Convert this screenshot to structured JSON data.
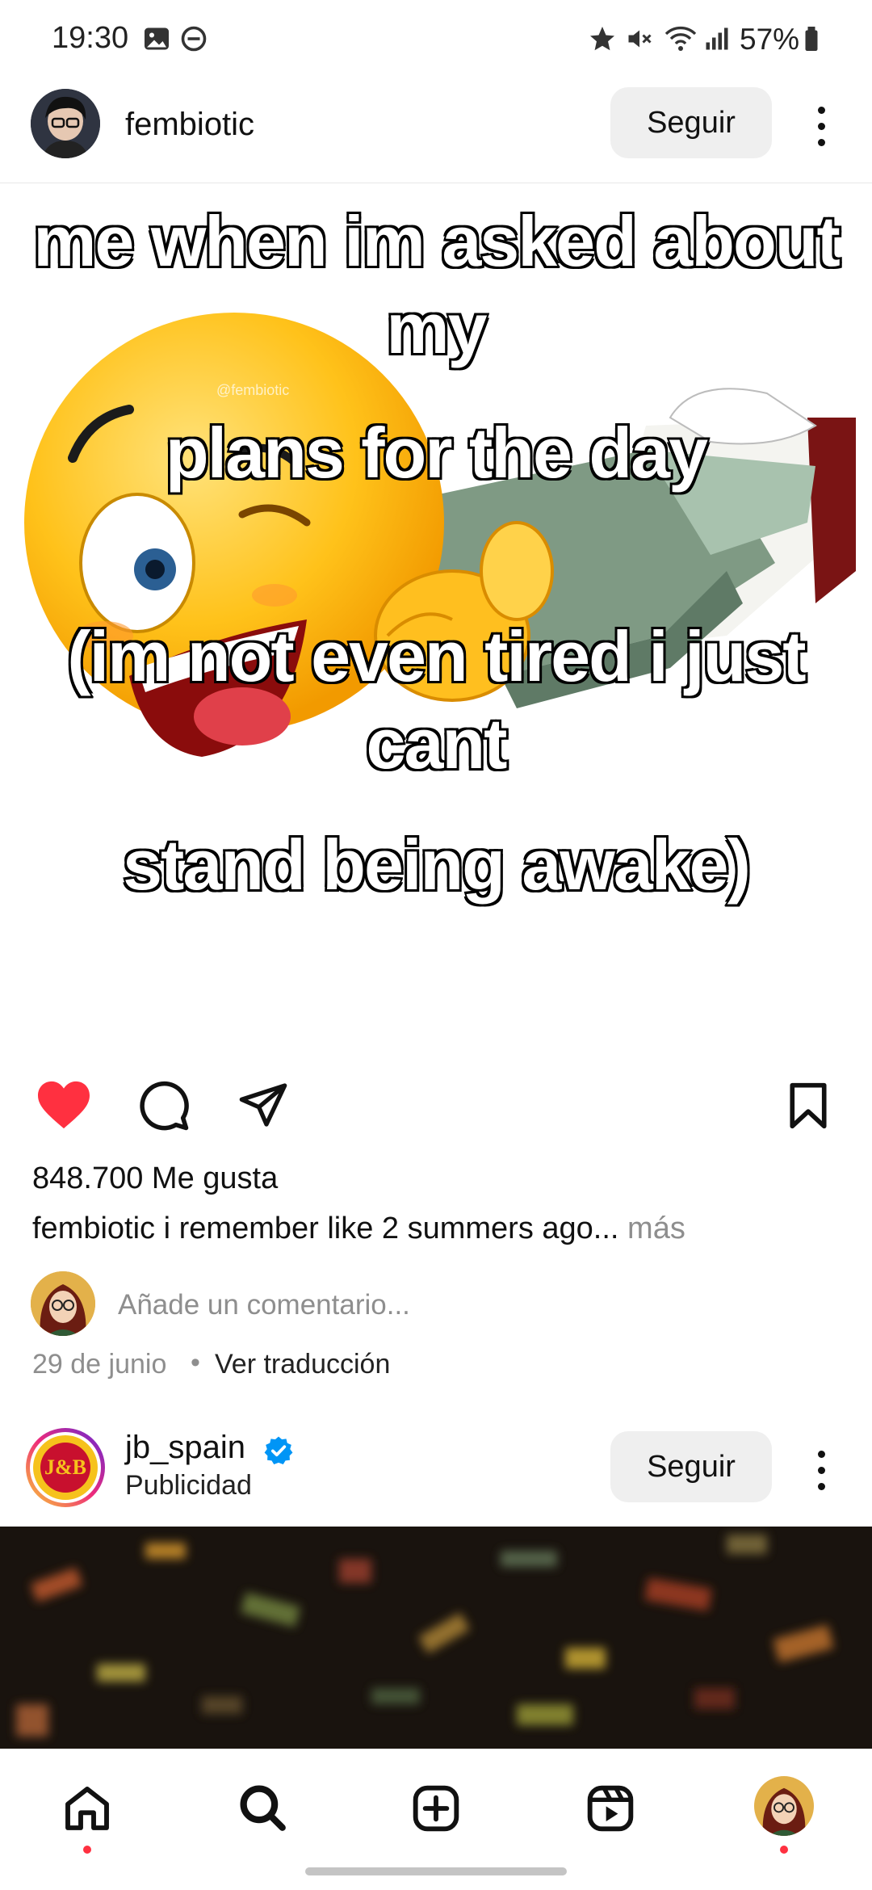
{
  "status_bar": {
    "time": "19:30",
    "battery": "57%"
  },
  "post": {
    "username": "fembiotic",
    "follow_label": "Seguir",
    "meme_text_top_line1": "me when im asked about my",
    "meme_text_top_line2": "plans for the day",
    "meme_text_bottom_line1": "(im not even tired i just cant",
    "meme_text_bottom_line2": "stand being awake)",
    "watermark": "@fembiotic",
    "likes": "848.700 Me gusta",
    "caption_user": "fembiotic",
    "caption_text": " i remember like 2 summers ago",
    "caption_ellipsis": "...",
    "caption_more": " más",
    "comment_placeholder": "Añade un comentario...",
    "date": "29 de junio",
    "separator": "•",
    "translate": "Ver traducción"
  },
  "ad": {
    "username": "jb_spain",
    "sponsored": "Publicidad",
    "follow_label": "Seguir",
    "logo_text": "J&B"
  },
  "colors": {
    "heart": "#ff3040",
    "verified": "#0095f6",
    "follow_bg": "#efefef"
  }
}
